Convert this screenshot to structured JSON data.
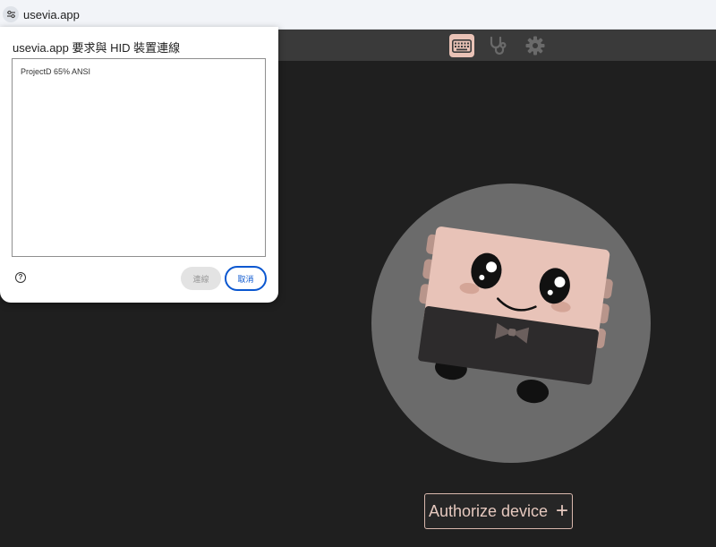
{
  "browser": {
    "url": "usevia.app",
    "site_icon": "site-settings-icon"
  },
  "app": {
    "nav": [
      {
        "icon": "keyboard-icon",
        "active": true
      },
      {
        "icon": "stethoscope-icon",
        "active": false
      },
      {
        "icon": "gear-icon",
        "active": false
      }
    ],
    "authorize_label": "Authorize device",
    "authorize_icon": "+",
    "accent_color": "#e9c2b6"
  },
  "dialog": {
    "title": "usevia.app 要求與 HID 裝置連線",
    "devices": [
      "ProjectD 65% ANSI"
    ],
    "help_icon": "?",
    "connect_label": "連線",
    "cancel_label": "取消",
    "primary_color": "#0b57d0"
  }
}
